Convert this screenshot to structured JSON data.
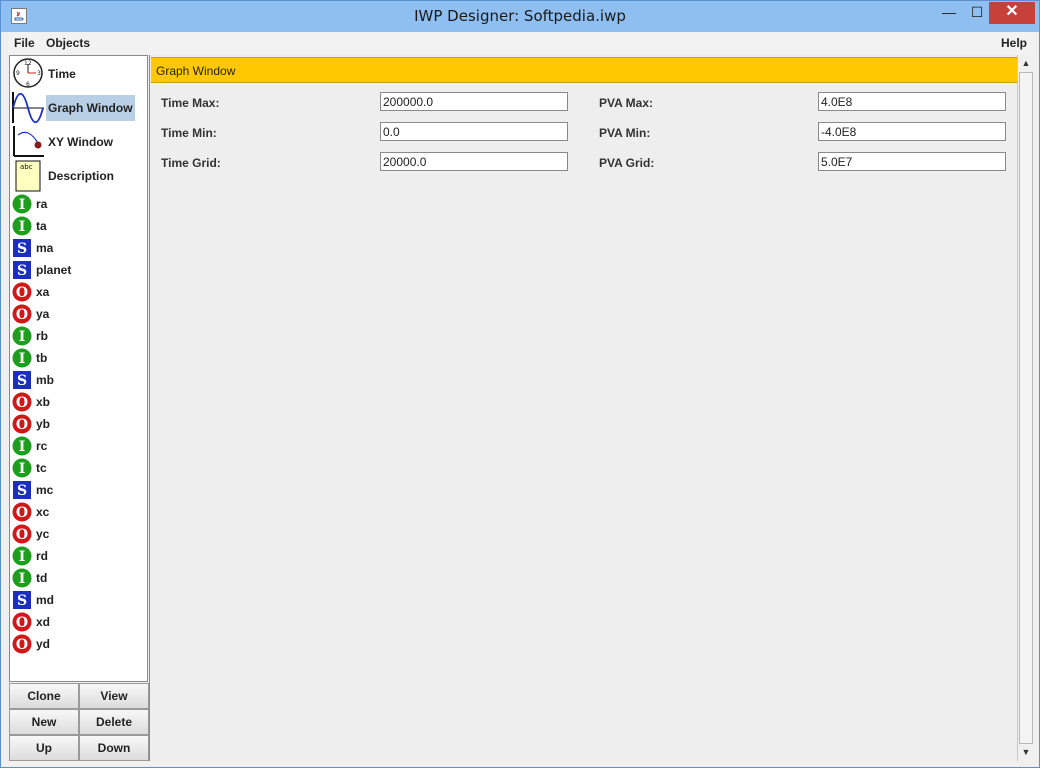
{
  "window": {
    "title": "IWP Designer: Softpedia.iwp",
    "minimize_glyph": "—",
    "maximize_glyph": "☐",
    "close_glyph": "✕"
  },
  "menubar": {
    "file": "File",
    "objects": "Objects",
    "help": "Help"
  },
  "sidebar": {
    "items": [
      {
        "label": "Time",
        "icon": "clock-icon"
      },
      {
        "label": "Graph Window",
        "icon": "sine-wave-icon",
        "selected": true
      },
      {
        "label": "XY Window",
        "icon": "xy-curve-icon"
      },
      {
        "label": "Description",
        "icon": "description-note-icon"
      }
    ],
    "objects": [
      {
        "label": "ra",
        "type": "I"
      },
      {
        "label": "ta",
        "type": "I"
      },
      {
        "label": "ma",
        "type": "S"
      },
      {
        "label": "planet",
        "type": "S"
      },
      {
        "label": "xa",
        "type": "O"
      },
      {
        "label": "ya",
        "type": "O"
      },
      {
        "label": "rb",
        "type": "I"
      },
      {
        "label": "tb",
        "type": "I"
      },
      {
        "label": "mb",
        "type": "S"
      },
      {
        "label": "xb",
        "type": "O"
      },
      {
        "label": "yb",
        "type": "O"
      },
      {
        "label": "rc",
        "type": "I"
      },
      {
        "label": "tc",
        "type": "I"
      },
      {
        "label": "mc",
        "type": "S"
      },
      {
        "label": "xc",
        "type": "O"
      },
      {
        "label": "yc",
        "type": "O"
      },
      {
        "label": "rd",
        "type": "I"
      },
      {
        "label": "td",
        "type": "I"
      },
      {
        "label": "md",
        "type": "S"
      },
      {
        "label": "xd",
        "type": "O"
      },
      {
        "label": "yd",
        "type": "O"
      }
    ],
    "buttons": {
      "clone": "Clone",
      "view": "View",
      "new": "New",
      "delete": "Delete",
      "up": "Up",
      "down": "Down"
    }
  },
  "main": {
    "header": "Graph Window",
    "fields": {
      "time_max": {
        "label": "Time Max:",
        "value": "200000.0"
      },
      "time_min": {
        "label": "Time Min:",
        "value": "0.0"
      },
      "time_grid": {
        "label": "Time Grid:",
        "value": "20000.0"
      },
      "pva_max": {
        "label": "PVA Max:",
        "value": "4.0E8"
      },
      "pva_min": {
        "label": "PVA Min:",
        "value": "-4.0E8"
      },
      "pva_grid": {
        "label": "PVA Grid:",
        "value": "5.0E7"
      }
    }
  },
  "colors": {
    "header_bar": "#ffc800",
    "selection": "#b8cfe5",
    "type_I": "#1e9e1e",
    "type_S": "#1a2fc0",
    "type_O": "#d01818"
  }
}
